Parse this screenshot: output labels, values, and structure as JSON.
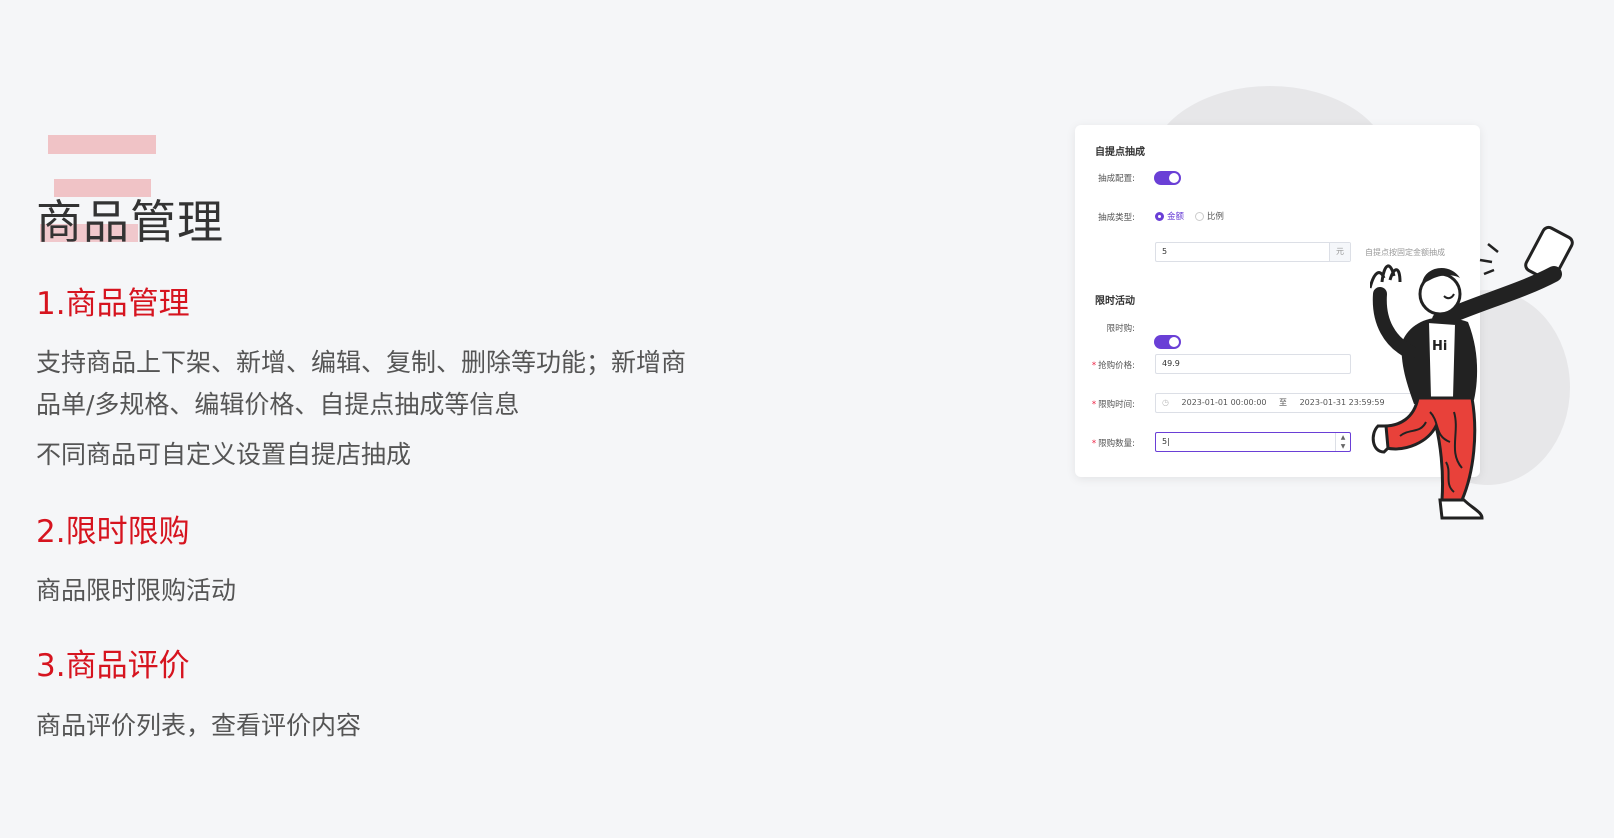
{
  "left": {
    "title": "商品管理",
    "sections": [
      {
        "heading": "1.商品管理",
        "lines": [
          "支持商品上下架、新增、编辑、复制、删除等功能；新增商",
          "品单/多规格、编辑价格、自提点抽成等信息",
          "不同商品可自定义设置自提店抽成"
        ]
      },
      {
        "heading": "2.限时限购",
        "lines": [
          "商品限时限购活动"
        ]
      },
      {
        "heading": "3.商品评价",
        "lines": [
          "商品评价列表，查看评价内容"
        ]
      }
    ]
  },
  "card": {
    "commission_section": "自提点抽成",
    "commission_config_label": "抽成配置:",
    "commission_config_on": true,
    "commission_type_label": "抽成类型:",
    "commission_type_options": [
      "金额",
      "比例"
    ],
    "commission_type_selected": "金额",
    "amount_value": "5",
    "amount_suffix": "元",
    "amount_hint": "自提点按固定金额抽成",
    "limited_section": "限时活动",
    "limited_buy_label": "限时购:",
    "limited_buy_on": true,
    "price_label": "抢购价格:",
    "price_value": "49.9",
    "time_label": "限购时间:",
    "time_start": "2023-01-01 00:00:00",
    "time_sep": "至",
    "time_end": "2023-01-31 23:59:59",
    "qty_label": "限购数量:",
    "qty_value": "5"
  },
  "colors": {
    "accent": "#6a3fd6",
    "heading_red": "#d6141f",
    "deco_pink": "#f0c3c6",
    "figure_red": "#e8413a"
  },
  "illustration": {
    "shirt_text": "Hi"
  }
}
